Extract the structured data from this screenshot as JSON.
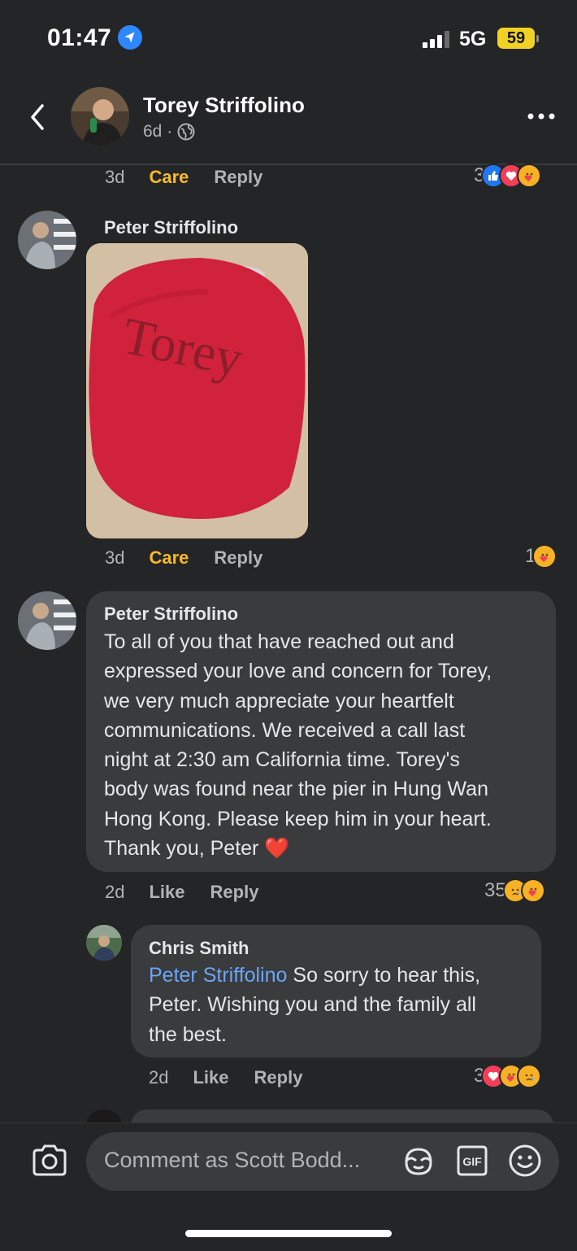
{
  "status_bar": {
    "time": "01:47",
    "network": "5G",
    "battery": "59"
  },
  "header": {
    "name": "Torey Striffolino",
    "meta": "6d ·"
  },
  "comments": [
    {
      "time": "3d",
      "care": "Care",
      "reply": "Reply",
      "reactions_count": "3"
    },
    {
      "author": "Peter Striffolino",
      "time": "3d",
      "care": "Care",
      "reply": "Reply",
      "reactions_count": "1",
      "photo_text": "Torey"
    },
    {
      "author": "Peter Striffolino",
      "lines": [
        "To all of you that have reached out and",
        "expressed your love and concern for Torey,",
        "we very much appreciate your heartfelt",
        "communications. We received a call last",
        "night at 2:30 am California time. Torey's",
        "body was found near the pier in Hung Wan",
        "Hong Kong. Please keep him in your heart.",
        "Thank you, Peter"
      ],
      "heart": "❤️",
      "time": "2d",
      "like": "Like",
      "reply": "Reply",
      "reactions_count": "35"
    },
    {
      "author": "Chris Smith",
      "mention": "Peter Striffolino",
      "line1_rest": " So sorry to hear this,",
      "line2": "Peter. Wishing you and the family all",
      "line3": "the best.",
      "time": "2d",
      "like": "Like",
      "reply": "Reply",
      "reactions_count": "3"
    }
  ],
  "composer": {
    "placeholder": "Comment as Scott Bodd...",
    "gif": "GIF"
  },
  "colors": {
    "background": "#242526",
    "bubble": "#3a3b3c",
    "care": "#f7b928",
    "mention": "#6aa6f8"
  }
}
